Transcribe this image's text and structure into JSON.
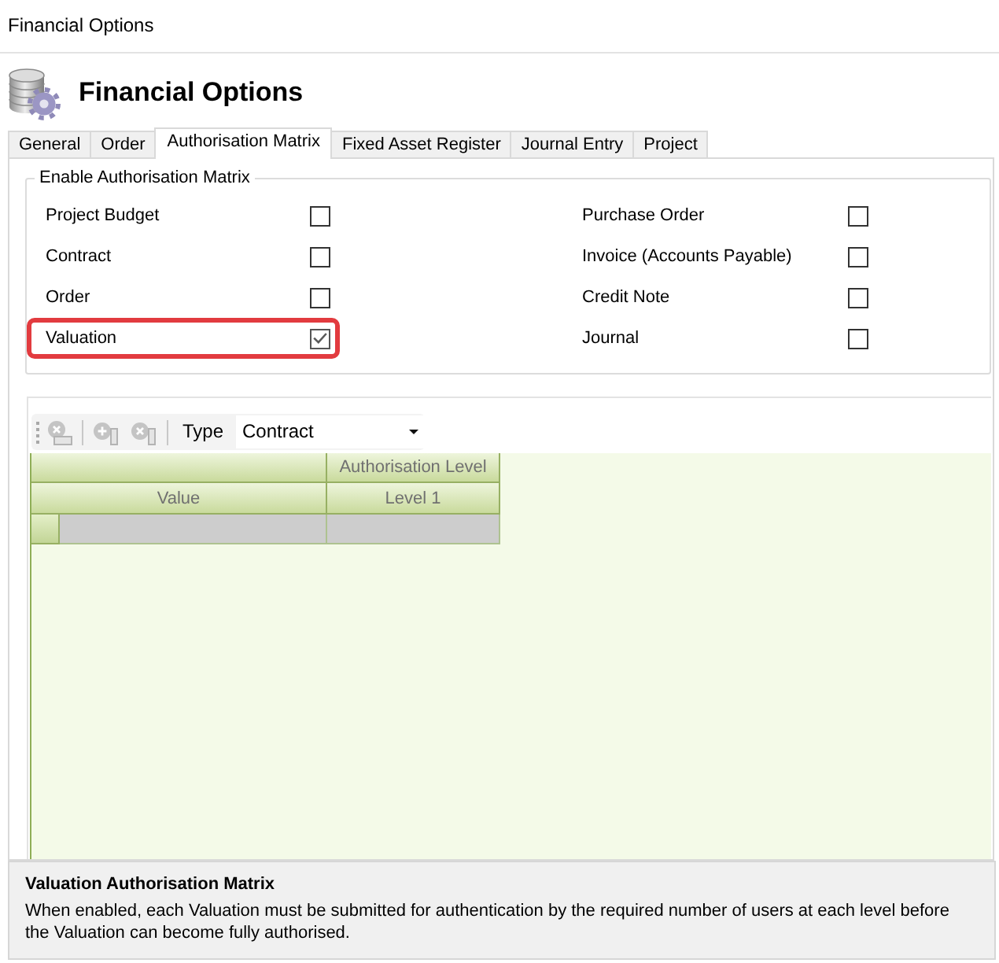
{
  "window": {
    "title": "Financial Options"
  },
  "header": {
    "title": "Financial Options"
  },
  "tabs": [
    {
      "label": "General",
      "selected": false
    },
    {
      "label": "Order",
      "selected": false
    },
    {
      "label": "Authorisation Matrix",
      "selected": true
    },
    {
      "label": "Fixed Asset Register",
      "selected": false
    },
    {
      "label": "Journal Entry",
      "selected": false
    },
    {
      "label": "Project",
      "selected": false
    }
  ],
  "enable_group": {
    "legend": "Enable Authorisation Matrix",
    "left_options": [
      {
        "label": "Project Budget",
        "checked": false,
        "highlighted": false
      },
      {
        "label": "Contract",
        "checked": false,
        "highlighted": false
      },
      {
        "label": "Order",
        "checked": false,
        "highlighted": false
      },
      {
        "label": "Valuation",
        "checked": true,
        "highlighted": true
      }
    ],
    "right_options": [
      {
        "label": "Purchase Order",
        "checked": false,
        "highlighted": false
      },
      {
        "label": "Invoice (Accounts Payable)",
        "checked": false,
        "highlighted": false
      },
      {
        "label": "Credit Note",
        "checked": false,
        "highlighted": false
      },
      {
        "label": "Journal",
        "checked": false,
        "highlighted": false
      }
    ]
  },
  "matrix": {
    "toolbar": {
      "buttons": [
        {
          "kind": "remove_row",
          "disabled": true
        },
        {
          "kind": "add_column",
          "disabled": true
        },
        {
          "kind": "remove_column",
          "disabled": true
        }
      ],
      "type_label": "Type",
      "type_value": "Contract"
    },
    "grid": {
      "group_header": "Authorisation Level",
      "columns": [
        "Value",
        "Level 1"
      ],
      "rows": [
        {
          "kind": "new"
        }
      ]
    }
  },
  "description": {
    "title": "Valuation Authorisation Matrix",
    "text": "When enabled, each Valuation must be submitted for authentication by the required number of users at each level before the Valuation can become fully authorised."
  }
}
